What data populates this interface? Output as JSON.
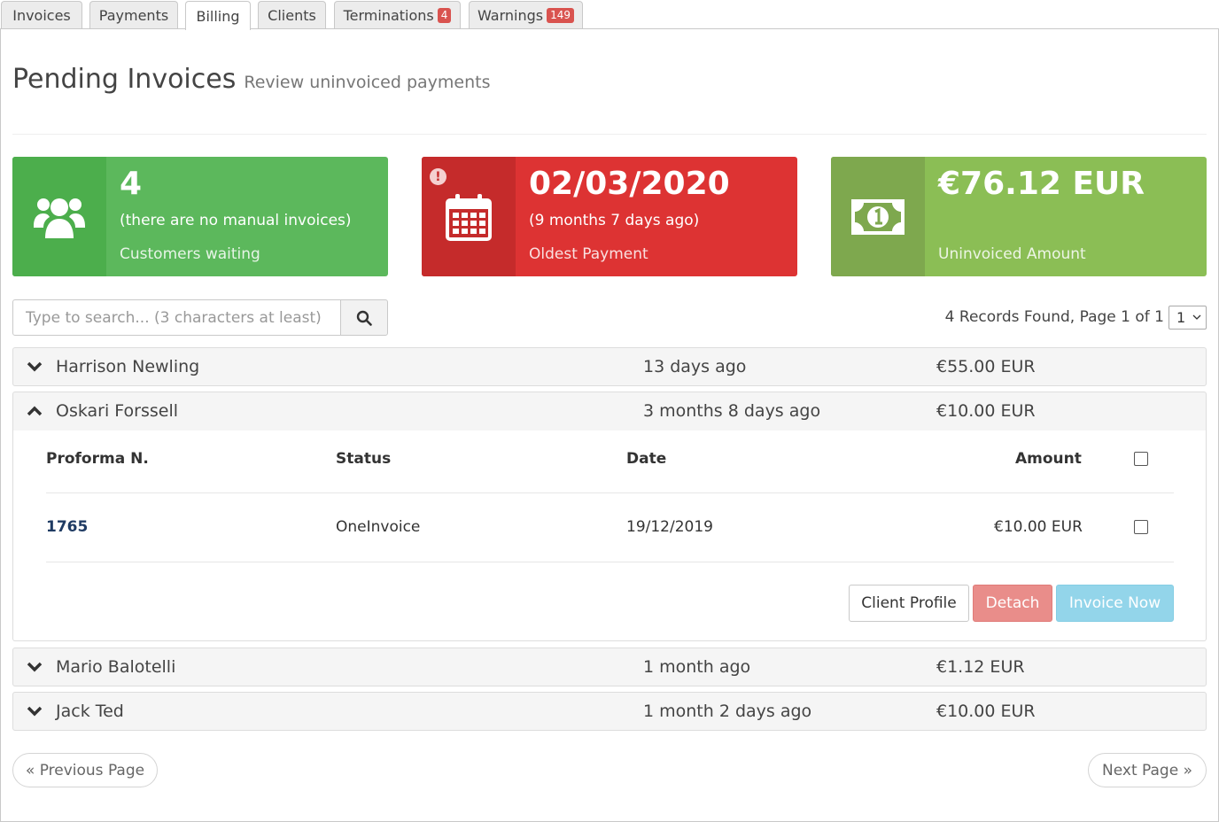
{
  "tabs": [
    {
      "label": "Invoices",
      "badge": null
    },
    {
      "label": "Payments",
      "badge": null
    },
    {
      "label": "Billing",
      "badge": null
    },
    {
      "label": "Clients",
      "badge": null
    },
    {
      "label": "Terminations",
      "badge": "4"
    },
    {
      "label": "Warnings",
      "badge": "149"
    }
  ],
  "active_tab": "Billing",
  "header": {
    "title": "Pending Invoices",
    "subtitle": "Review uninvoiced payments"
  },
  "info_boxes": {
    "customers": {
      "number": "4",
      "text": "(there are no manual invoices)",
      "label": "Customers waiting",
      "icon": "users-icon"
    },
    "oldest": {
      "number": "02/03/2020",
      "text": "(9 months 7 days ago)",
      "label": "Oldest Payment",
      "icon": "calendar-icon",
      "alert": "!"
    },
    "amount": {
      "number": "€76.12 EUR",
      "text": "",
      "label": "Uninvoiced Amount",
      "icon": "money-icon"
    }
  },
  "search": {
    "placeholder": "Type to search... (3 characters at least)",
    "value": ""
  },
  "records": {
    "summary": "4 Records Found, Page 1 of 1",
    "page_selected": "1"
  },
  "rows": [
    {
      "name": "Harrison Newling",
      "age": "13 days ago",
      "amount": "€55.00 EUR",
      "expanded": false
    },
    {
      "name": "Oskari Forssell",
      "age": "3 months 8 days ago",
      "amount": "€10.00 EUR",
      "expanded": true
    },
    {
      "name": "Mario Balotelli",
      "age": "1 month ago",
      "amount": "€1.12 EUR",
      "expanded": false
    },
    {
      "name": "Jack Ted",
      "age": "1 month 2 days ago",
      "amount": "€10.00 EUR",
      "expanded": false
    }
  ],
  "detail": {
    "columns": {
      "proforma": "Proforma N.",
      "status": "Status",
      "date": "Date",
      "amount": "Amount"
    },
    "items": [
      {
        "proforma": "1765",
        "status": "OneInvoice",
        "date": "19/12/2019",
        "amount": "€10.00 EUR"
      }
    ],
    "buttons": {
      "profile": "Client Profile",
      "detach": "Detach",
      "invoice": "Invoice Now"
    }
  },
  "pagination": {
    "prev": "« Previous Page",
    "next": "Next Page »"
  },
  "colors": {
    "green": "#5cb85c",
    "red": "#dd3333",
    "olive": "#8bbe55",
    "badge": "#d9534f",
    "link": "#1f3b63"
  }
}
